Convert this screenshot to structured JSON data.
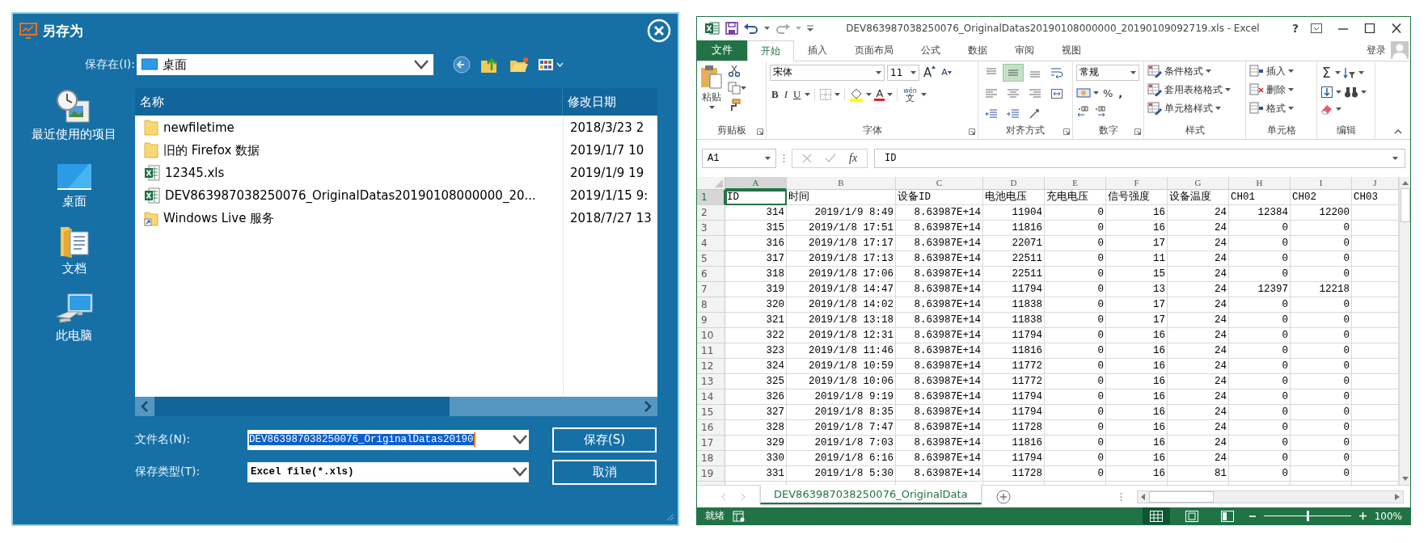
{
  "save_dialog": {
    "title": "另存为",
    "location_label": "保存在(I):",
    "location": "桌面",
    "places": [
      {
        "kind": "recent",
        "label": "最近使用的项目"
      },
      {
        "kind": "desktop",
        "label": "桌面"
      },
      {
        "kind": "documents",
        "label": "文档"
      },
      {
        "kind": "computer",
        "label": "此电脑"
      }
    ],
    "file_list": {
      "columns": [
        "名称",
        "修改日期"
      ],
      "rows": [
        {
          "kind": "folder",
          "name": "newfiletime",
          "modified": "2018/3/23 2"
        },
        {
          "kind": "folder",
          "name": "旧的 Firefox 数据",
          "modified": "2019/1/7 10"
        },
        {
          "kind": "excel",
          "name": "12345.xls",
          "modified": "2019/1/9 19"
        },
        {
          "kind": "excel",
          "name": "DEV863987038250076_OriginalDatas20190108000000_20...",
          "modified": "2019/1/15 9:"
        },
        {
          "kind": "shortcut",
          "name": "Windows Live 服务",
          "modified": "2018/7/27 13"
        }
      ]
    },
    "file_name_label": "文件名(N):",
    "file_name": "DEV863987038250076_OriginalDatas20190",
    "file_type_label": "保存类型(T):",
    "file_type": "Excel file(*.xls)",
    "buttons": [
      "保存(S)",
      "取消"
    ]
  },
  "excel": {
    "title": "DEV863987038250076_OriginalDatas20190108000000_20190109092719.xls - Excel",
    "help": "?",
    "file_tab": "文件",
    "tabs": [
      {
        "label": "开始",
        "selected": true
      },
      {
        "label": "插入",
        "selected": false
      },
      {
        "label": "页面布局",
        "selected": false
      },
      {
        "label": "公式",
        "selected": false
      },
      {
        "label": "数据",
        "selected": false
      },
      {
        "label": "审阅",
        "selected": false
      },
      {
        "label": "视图",
        "selected": false
      }
    ],
    "sign_in": "登录",
    "ribbon": {
      "clipboard": {
        "paste": "粘贴",
        "label": "剪贴板"
      },
      "font": {
        "name": "宋体",
        "size": "11",
        "grow": "A",
        "shrink": "A",
        "bold": "B",
        "italic": "I",
        "underline": "U",
        "color_letter": "A",
        "phonetic_top": "wén",
        "phonetic": "文",
        "label": "字体"
      },
      "alignment": {
        "buttons": [
          {
            "kind": "top",
            "on": false
          },
          {
            "kind": "middle",
            "on": true
          },
          {
            "kind": "bottom",
            "on": false
          },
          {
            "kind": "wrap",
            "on": false
          },
          {
            "kind": "left",
            "on": false
          },
          {
            "kind": "center",
            "on": false
          },
          {
            "kind": "right",
            "on": false
          },
          {
            "kind": "merge",
            "on": false
          },
          {
            "kind": "outdent",
            "on": false
          },
          {
            "kind": "indent",
            "on": false
          },
          {
            "kind": "orientation",
            "on": false
          }
        ],
        "label": "对齐方式"
      },
      "number": {
        "format": "常规",
        "percent": "%",
        "comma": ",",
        "label": "数字"
      },
      "styles": {
        "items": [
          "条件格式",
          "套用表格格式",
          "单元格样式"
        ],
        "label": "样式"
      },
      "cells": {
        "items": [
          "插入",
          "删除",
          "格式"
        ],
        "label": "单元格"
      },
      "editing": {
        "sum": "Σ",
        "label": "编辑"
      }
    },
    "name_box": "A1",
    "function_label": "fx",
    "formula": "ID",
    "columns": [
      {
        "label": "A",
        "selected": true
      },
      {
        "label": "B",
        "selected": false
      },
      {
        "label": "C",
        "selected": false
      },
      {
        "label": "D",
        "selected": false
      },
      {
        "label": "E",
        "selected": false
      },
      {
        "label": "F",
        "selected": false
      },
      {
        "label": "G",
        "selected": false
      },
      {
        "label": "H",
        "selected": false
      },
      {
        "label": "I",
        "selected": false
      },
      {
        "label": "J",
        "selected": false
      }
    ],
    "rows": [
      {
        "number": "1",
        "selected": true,
        "kind": "header",
        "cells": [
          "ID",
          "时间",
          "设备ID",
          "电池电压",
          "充电电压",
          "信号强度",
          "设备温度",
          "CH01",
          "CH02",
          "CH03"
        ]
      },
      {
        "number": "2",
        "selected": false,
        "kind": "data",
        "cells": [
          "314",
          "2019/1/9 8:49",
          "8.63987E+14",
          "11904",
          "0",
          "16",
          "24",
          "12384",
          "12200"
        ]
      },
      {
        "number": "3",
        "selected": false,
        "kind": "data",
        "cells": [
          "315",
          "2019/1/8 17:51",
          "8.63987E+14",
          "11816",
          "0",
          "16",
          "24",
          "0",
          "0"
        ]
      },
      {
        "number": "4",
        "selected": false,
        "kind": "data",
        "cells": [
          "316",
          "2019/1/8 17:17",
          "8.63987E+14",
          "22071",
          "0",
          "17",
          "24",
          "0",
          "0"
        ]
      },
      {
        "number": "5",
        "selected": false,
        "kind": "data",
        "cells": [
          "317",
          "2019/1/8 17:13",
          "8.63987E+14",
          "22511",
          "0",
          "11",
          "24",
          "0",
          "0"
        ]
      },
      {
        "number": "6",
        "selected": false,
        "kind": "data",
        "cells": [
          "318",
          "2019/1/8 17:06",
          "8.63987E+14",
          "22511",
          "0",
          "15",
          "24",
          "0",
          "0"
        ]
      },
      {
        "number": "7",
        "selected": false,
        "kind": "data",
        "cells": [
          "319",
          "2019/1/8 14:47",
          "8.63987E+14",
          "11794",
          "0",
          "13",
          "24",
          "12397",
          "12218"
        ]
      },
      {
        "number": "8",
        "selected": false,
        "kind": "data",
        "cells": [
          "320",
          "2019/1/8 14:02",
          "8.63987E+14",
          "11838",
          "0",
          "17",
          "24",
          "0",
          "0"
        ]
      },
      {
        "number": "9",
        "selected": false,
        "kind": "data",
        "cells": [
          "321",
          "2019/1/8 13:18",
          "8.63987E+14",
          "11838",
          "0",
          "17",
          "24",
          "0",
          "0"
        ]
      },
      {
        "number": "10",
        "selected": false,
        "kind": "data",
        "cells": [
          "322",
          "2019/1/8 12:31",
          "8.63987E+14",
          "11794",
          "0",
          "16",
          "24",
          "0",
          "0"
        ]
      },
      {
        "number": "11",
        "selected": false,
        "kind": "data",
        "cells": [
          "323",
          "2019/1/8 11:46",
          "8.63987E+14",
          "11816",
          "0",
          "16",
          "24",
          "0",
          "0"
        ]
      },
      {
        "number": "12",
        "selected": false,
        "kind": "data",
        "cells": [
          "324",
          "2019/1/8 10:59",
          "8.63987E+14",
          "11772",
          "0",
          "16",
          "24",
          "0",
          "0"
        ]
      },
      {
        "number": "13",
        "selected": false,
        "kind": "data",
        "cells": [
          "325",
          "2019/1/8 10:06",
          "8.63987E+14",
          "11772",
          "0",
          "16",
          "24",
          "0",
          "0"
        ]
      },
      {
        "number": "14",
        "selected": false,
        "kind": "data",
        "cells": [
          "326",
          "2019/1/8 9:19",
          "8.63987E+14",
          "11794",
          "0",
          "16",
          "24",
          "0",
          "0"
        ]
      },
      {
        "number": "15",
        "selected": false,
        "kind": "data",
        "cells": [
          "327",
          "2019/1/8 8:35",
          "8.63987E+14",
          "11794",
          "0",
          "16",
          "24",
          "0",
          "0"
        ]
      },
      {
        "number": "16",
        "selected": false,
        "kind": "data",
        "cells": [
          "328",
          "2019/1/8 7:47",
          "8.63987E+14",
          "11728",
          "0",
          "16",
          "24",
          "0",
          "0"
        ]
      },
      {
        "number": "17",
        "selected": false,
        "kind": "data",
        "cells": [
          "329",
          "2019/1/8 7:03",
          "8.63987E+14",
          "11816",
          "0",
          "16",
          "24",
          "0",
          "0"
        ]
      },
      {
        "number": "18",
        "selected": false,
        "kind": "data",
        "cells": [
          "330",
          "2019/1/8 6:16",
          "8.63987E+14",
          "11794",
          "0",
          "16",
          "24",
          "0",
          "0"
        ]
      },
      {
        "number": "19",
        "selected": false,
        "kind": "data",
        "cells": [
          "331",
          "2019/1/8 5:30",
          "8.63987E+14",
          "11728",
          "0",
          "16",
          "81",
          "0",
          "0"
        ]
      }
    ],
    "sheet_tab": "DEV863987038250076_OriginalData",
    "status": "就绪",
    "zoom": {
      "level": 0.5,
      "reading": "100%"
    }
  }
}
